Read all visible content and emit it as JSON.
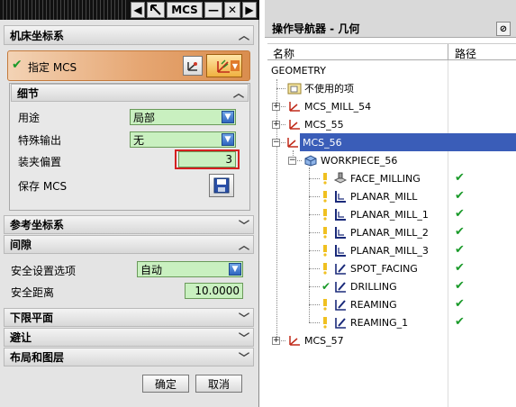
{
  "dialog": {
    "title": "MCS",
    "title_icon": "pointer-icon",
    "minimize_glyph": "—",
    "close_glyph": "✕",
    "prev_glyph": "◀",
    "next_glyph": "▶",
    "sections": {
      "machine_csys": "机床坐标系",
      "reference_csys": "参考坐标系",
      "clearance": "间隙",
      "lower_limit": "下限平面",
      "avoidance": "避让",
      "layout_layers": "布局和图层"
    },
    "specify_mcs": "指定 MCS",
    "details": {
      "header": "细节",
      "purpose_label": "用途",
      "purpose_value": "局部",
      "special_output_label": "特殊输出",
      "special_output_value": "无",
      "fixture_offset_label": "装夹偏置",
      "fixture_offset_value": "3",
      "save_mcs_label": "保存 MCS"
    },
    "clearance": {
      "safety_option_label": "安全设置选项",
      "safety_option_value": "自动",
      "safety_distance_label": "安全距离",
      "safety_distance_value": "10.0000"
    },
    "buttons": {
      "ok": "确定",
      "cancel": "取消"
    },
    "accent_color": "#d98d4e"
  },
  "navigator": {
    "title": "操作导航器 - 几何",
    "col_name": "名称",
    "col_path": "路径",
    "root": "GEOMETRY",
    "rows": [
      {
        "label": "不使用的项"
      },
      {
        "label": "MCS_MILL_54"
      },
      {
        "label": "MCS_55"
      },
      {
        "label": "MCS_56"
      },
      {
        "label": "WORKPIECE_56"
      },
      {
        "label": "FACE_MILLING"
      },
      {
        "label": "PLANAR_MILL"
      },
      {
        "label": "PLANAR_MILL_1"
      },
      {
        "label": "PLANAR_MILL_2"
      },
      {
        "label": "PLANAR_MILL_3"
      },
      {
        "label": "SPOT_FACING"
      },
      {
        "label": "DRILLING"
      },
      {
        "label": "REAMING"
      },
      {
        "label": "REAMING_1"
      },
      {
        "label": "MCS_57"
      }
    ],
    "path_mark": "✔",
    "selected_color": "#3a5db8"
  }
}
